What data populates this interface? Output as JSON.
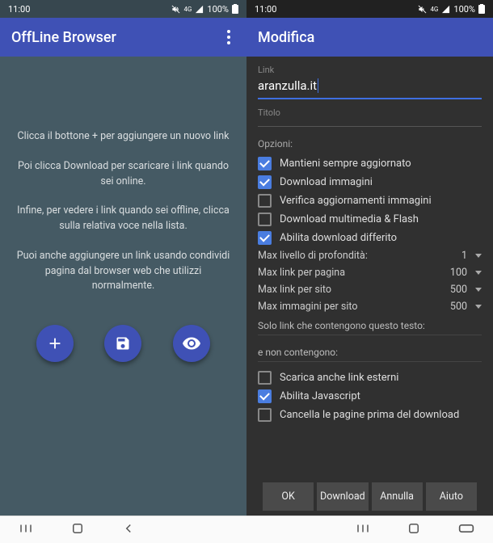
{
  "status": {
    "time": "11:00",
    "battery": "100%",
    "network": "4G"
  },
  "left": {
    "appbar_title": "OffLine Browser",
    "p1": "Clicca il bottone + per aggiungere un nuovo link",
    "p2": "Poi clicca Download per scaricare i link quando sei online.",
    "p3": "Infine, per vedere i link quando sei offline, clicca sulla relativa voce nella lista.",
    "p4": "Puoi anche aggiungere un link usando condividi pagina dal browser web che utilizzi normalmente."
  },
  "right": {
    "appbar_title": "Modifica",
    "link_label": "Link",
    "link_value": "aranzulla.it",
    "title_label": "Titolo",
    "title_value": "",
    "options_label": "Opzioni:",
    "options": [
      {
        "label": "Mantieni sempre aggiornato",
        "checked": true
      },
      {
        "label": "Download immagini",
        "checked": true
      },
      {
        "label": "Verifica aggiornamenti immagini",
        "checked": false
      },
      {
        "label": "Download multimedia & Flash",
        "checked": false
      },
      {
        "label": "Abilita download differito",
        "checked": true
      }
    ],
    "numbers": [
      {
        "label": "Max livello di profondità:",
        "value": "1"
      },
      {
        "label": "Max link per pagina",
        "value": "100"
      },
      {
        "label": "Max link per sito",
        "value": "500"
      },
      {
        "label": "Max immagini per sito",
        "value": "500"
      }
    ],
    "filter_contains": "Solo link che contengono questo testo:",
    "filter_not": "e non contengono:",
    "extra": [
      {
        "label": "Scarica anche link esterni",
        "checked": false
      },
      {
        "label": "Abilita Javascript",
        "checked": true
      },
      {
        "label": "Cancella le pagine prima del download",
        "checked": false
      }
    ],
    "buttons": {
      "ok": "OK",
      "download": "Download",
      "cancel": "Annulla",
      "help": "Aiuto"
    }
  }
}
